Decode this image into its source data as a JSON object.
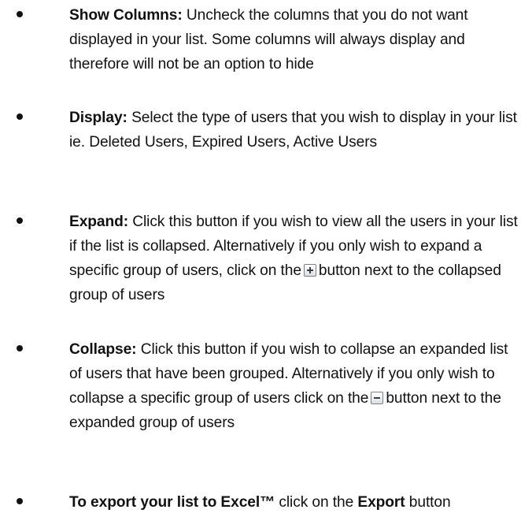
{
  "items": [
    {
      "bold": "Show Columns:",
      "text": " Uncheck the columns that you do not want displayed in your list. Some columns will always display and therefore will not be an option to hide"
    },
    {
      "bold": "Display:",
      "text": " Select the type of users that you wish to display in your list ie. Deleted Users, Expired Users, Active Users"
    },
    {
      "bold": "Expand:",
      "text_before_icon": " Click this button if you wish to view all the users in your list if the list is collapsed. Alternatively if you only wish to expand a specific group of users, click on the",
      "icon": "expand-plus-icon",
      "text_after_icon": "button next to the collapsed group of users"
    },
    {
      "bold": "Collapse:",
      "text_before_icon": " Click this button if you wish to collapse an expanded list of users that have been grouped. Alternatively if you only wish to collapse a specific group of users click on the",
      "icon": "collapse-minus-icon",
      "text_after_icon": "button next to the expanded group of users"
    },
    {
      "bold_1": "To export your list to Excel™",
      "text_1": " click on the ",
      "bold_2": "Export",
      "text_2": " button"
    }
  ]
}
